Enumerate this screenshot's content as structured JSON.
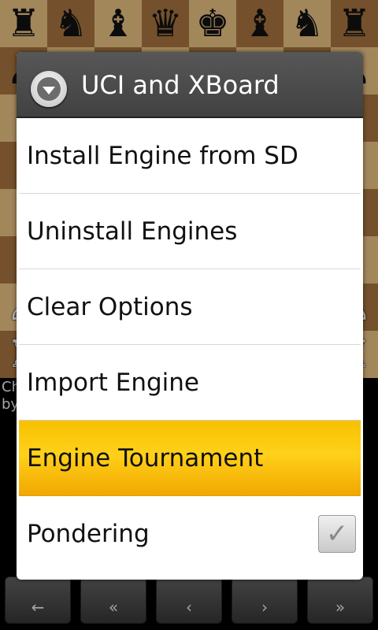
{
  "board": {
    "rows": [
      [
        "♜",
        "♞",
        "♝",
        "♛",
        "♚",
        "♝",
        "♞",
        "♜"
      ],
      [
        "♟",
        "♟",
        "♟",
        "♟",
        "♟",
        "♟",
        "♟",
        "♟"
      ],
      [
        "",
        "",
        "",
        "",
        "",
        "",
        "",
        ""
      ],
      [
        "",
        "",
        "",
        "",
        "",
        "",
        "",
        ""
      ],
      [
        "",
        "",
        "",
        "",
        "",
        "",
        "",
        ""
      ],
      [
        "",
        "",
        "",
        "",
        "",
        "",
        "",
        ""
      ],
      [
        "♙",
        "♙",
        "♙",
        "♙",
        "♙",
        "♙",
        "♙",
        "♙"
      ],
      [
        "♖",
        "♘",
        "♗",
        "♕",
        "♔",
        "♗",
        "♘",
        "♖"
      ]
    ]
  },
  "status": {
    "line1": "Ch",
    "line2": "by"
  },
  "dialog": {
    "title": "UCI and XBoard",
    "icon": "dropdown-arrow-icon",
    "items": [
      {
        "label": "Install Engine from SD"
      },
      {
        "label": "Uninstall Engines"
      },
      {
        "label": "Clear Options"
      },
      {
        "label": "Import Engine"
      },
      {
        "label": "Engine Tournament",
        "selected": true
      },
      {
        "label": "Pondering",
        "checkbox": true,
        "checked": true
      }
    ],
    "selected_color": "#ffc400"
  },
  "nav": {
    "buttons": [
      "←",
      "«",
      "‹",
      "›",
      "»"
    ]
  }
}
